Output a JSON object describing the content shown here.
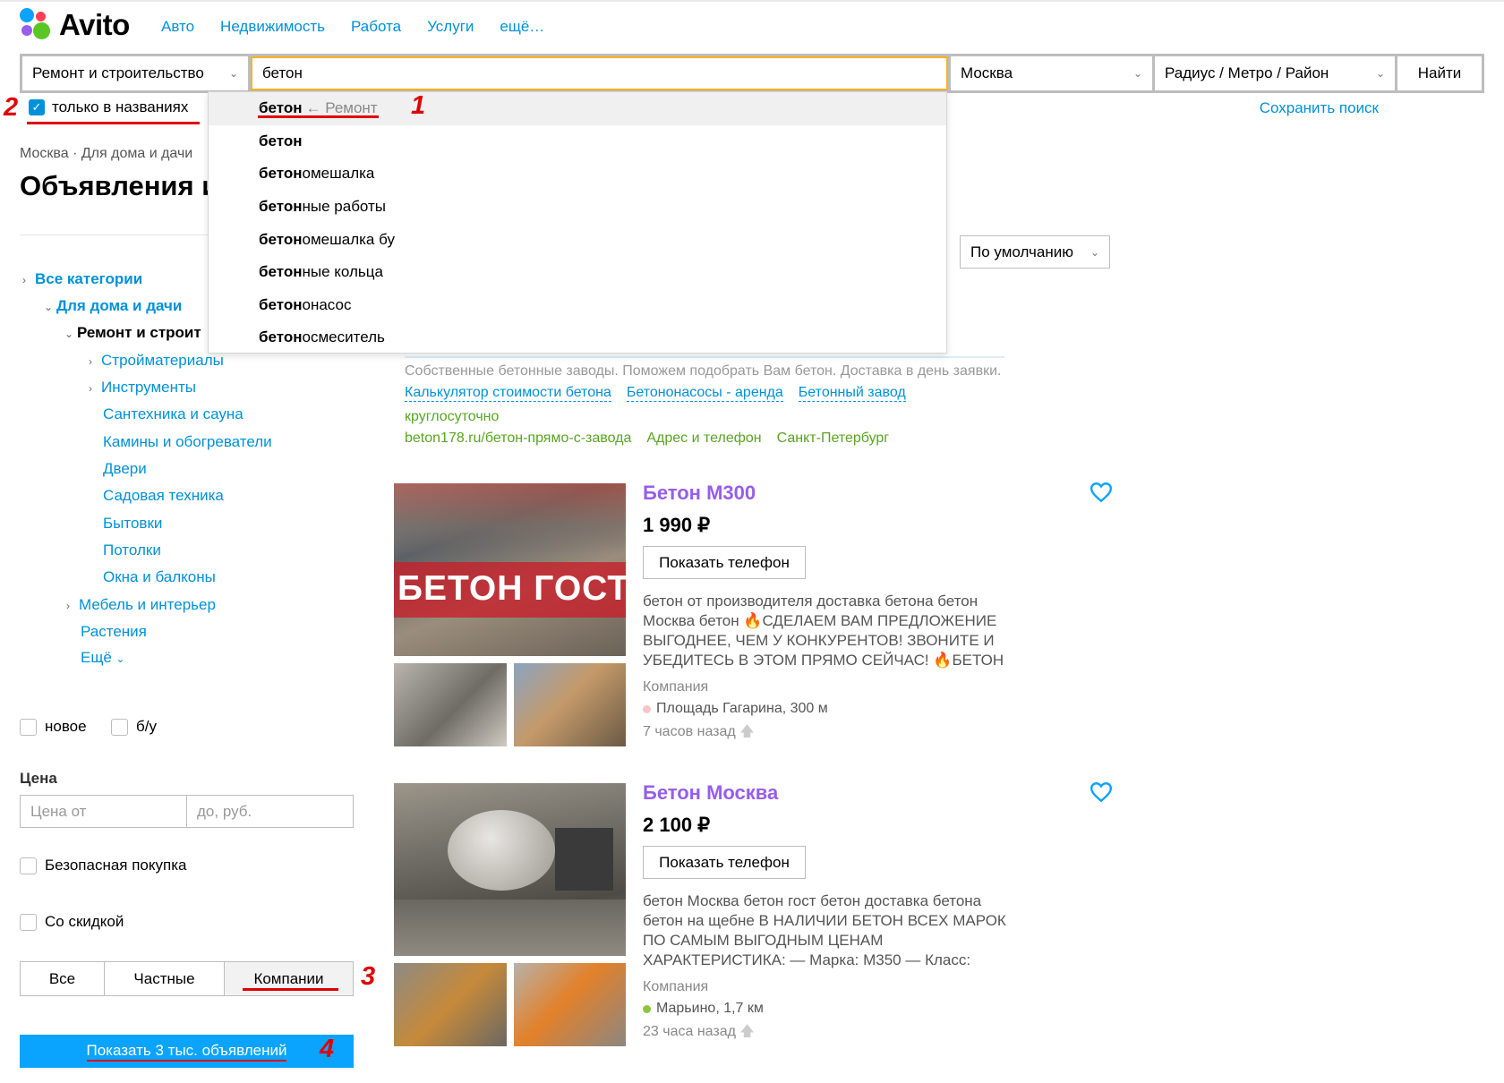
{
  "brand": {
    "name": "Avito",
    "colors": {
      "blue": "#0091d9",
      "green": "#59a521",
      "purple": "#965eeb",
      "red": "#e00000",
      "orange": "#ffb021"
    }
  },
  "nav": [
    "Авто",
    "Недвижимость",
    "Работа",
    "Услуги",
    "ещё…"
  ],
  "search": {
    "category": "Ремонт и строительство",
    "query": "бетон",
    "city": "Москва",
    "radius": "Радиус / Метро / Район",
    "find_label": "Найти",
    "only_titles_label": "только в названиях",
    "only_titles_checked": true,
    "save_label": "Сохранить поиск"
  },
  "suggestions": [
    {
      "bold": "бетон",
      "rest": "",
      "hint": "← Ремонт"
    },
    {
      "bold": "бетон",
      "rest": "",
      "hint": ""
    },
    {
      "bold": "бетон",
      "rest": "омешалка",
      "hint": ""
    },
    {
      "bold": "бетон",
      "rest": "ные работы",
      "hint": ""
    },
    {
      "bold": "бетон",
      "rest": "омешалка бу",
      "hint": ""
    },
    {
      "bold": "бетон",
      "rest": "ные кольца",
      "hint": ""
    },
    {
      "bold": "бетон",
      "rest": "онасос",
      "hint": ""
    },
    {
      "bold": "бетон",
      "rest": "осмеситель",
      "hint": ""
    }
  ],
  "breadcrumbs": "Москва · Для дома и дачи",
  "page_title": "Объявления и",
  "tree": {
    "all": "Все категории",
    "home": "Для дома и дачи",
    "repair": "Ремонт и строит",
    "children": [
      "Стройматериалы",
      "Инструменты",
      "Сантехника и сауна",
      "Камины и обогреватели",
      "Двери",
      "Садовая техника",
      "Бытовки",
      "Потолки",
      "Окна и балконы"
    ],
    "furniture": "Мебель и интерьер",
    "plants": "Растения",
    "more": "Ещё"
  },
  "filters": {
    "new_label": "новое",
    "used_label": "б/у",
    "price_label": "Цена",
    "price_from_placeholder": "Цена от",
    "price_to_placeholder": "до, руб.",
    "safe_label": "Безопасная покупка",
    "discount_label": "Со скидкой",
    "seller_tabs": [
      "Все",
      "Частные",
      "Компании"
    ],
    "show_label": "Показать 3 тыс. объявлений"
  },
  "sort": {
    "label": "По умолчанию"
  },
  "annotations": [
    "1",
    "2",
    "3",
    "4"
  ],
  "ad": {
    "text": "Собственные бетонные заводы. Поможем подобрать Вам бетон. Доставка в день заявки.",
    "links": [
      "Калькулятор стоимости бетона",
      "Бетононасосы - аренда",
      "Бетонный завод"
    ],
    "green1": "круглосуточно",
    "green2": [
      "beton178.ru/бетон-прямо-с-завода",
      "Адрес и телефон",
      "Санкт-Петербург"
    ]
  },
  "listings": [
    {
      "title": "Бетон М300",
      "price": "1 990 ₽",
      "phone_label": "Показать телефон",
      "image_caption": "БЕТОН ГОСТ",
      "desc": "бетон от производителя доставка бетона бетон Москва бетон 🔥СДЕЛАЕМ ВАМ ПРЕДЛОЖЕНИЕ ВЫГОДНЕЕ, ЧЕМ У КОНКУРЕНТОВ! ЗВОНИТЕ И УБЕДИТЕСЬ В ЭТОМ ПРЯМО СЕЙЧАС! 🔥БЕТОН",
      "seller": "Компания",
      "metro": "Площадь Гагарина, 300 м",
      "metro_color": "#f5c6c6",
      "time": "7 часов назад"
    },
    {
      "title": "Бетон Москва",
      "price": "2 100 ₽",
      "phone_label": "Показать телефон",
      "image_caption": "",
      "desc": "бетон Москва бетон гост бетон доставка бетона бетон на щебне В НАЛИЧИИ БЕТОН ВСЕХ МАРОК ПО САМЫМ ВЫГОДНЫМ ЦЕНАМ ХАРАКТЕРИСТИКА: — Марка: М350 — Класс:",
      "seller": "Компания",
      "metro": "Марьино, 1,7 км",
      "metro_color": "#8cc63f",
      "time": "23 часа назад"
    }
  ]
}
